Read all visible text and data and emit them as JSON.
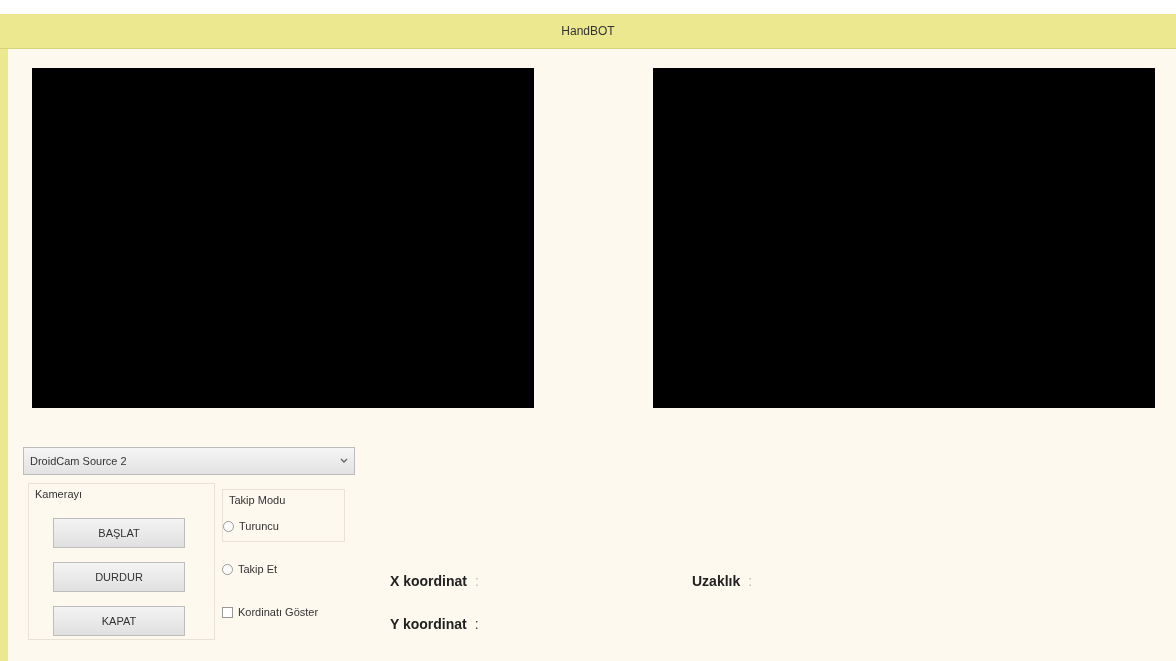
{
  "window": {
    "title": "HandBOT"
  },
  "camera_select": {
    "value": "DroidCam Source 2"
  },
  "camera_group": {
    "title": "Kamerayı",
    "buttons": [
      "BAŞLAT",
      "DURDUR",
      "KAPAT"
    ]
  },
  "tracking_group": {
    "title": "Takip Modu"
  },
  "options": [
    {
      "kind": "radio",
      "label": "Turuncu",
      "checked": false
    },
    {
      "kind": "radio",
      "label": "Takip Et",
      "checked": false
    },
    {
      "kind": "checkbox",
      "label": "Kordinatı Göster",
      "checked": false
    }
  ],
  "readouts": [
    {
      "label": "X koordinat",
      "separator": ":"
    },
    {
      "label": "Uzaklık",
      "separator": ":"
    },
    {
      "label": "Y koordinat",
      "separator": ":"
    }
  ]
}
